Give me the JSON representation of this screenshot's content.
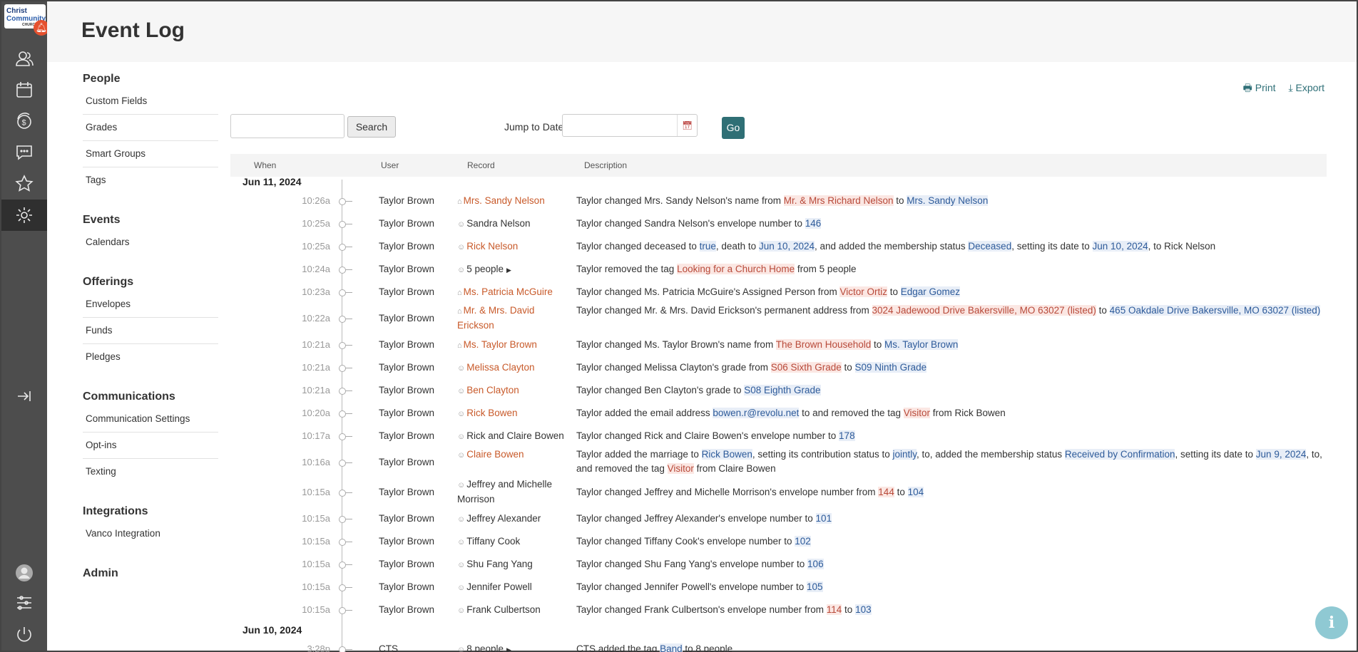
{
  "app": {
    "logo_line1": "Christ",
    "logo_line2": "Community",
    "logo_line3": "CHURCH",
    "notification_icon": "bell-icon",
    "rail_icons": [
      "people-icon",
      "calendar-icon",
      "offerings-icon",
      "messages-icon",
      "star-icon",
      "gear-icon",
      "collapse-icon",
      "avatar",
      "sliders-icon",
      "power-icon"
    ]
  },
  "header": {
    "title": "Event Log"
  },
  "subnav": {
    "sections": [
      {
        "title": "People",
        "items": [
          "Custom Fields",
          "Grades",
          "Smart Groups",
          "Tags"
        ]
      },
      {
        "title": "Events",
        "items": [
          "Calendars"
        ]
      },
      {
        "title": "Offerings",
        "items": [
          "Envelopes",
          "Funds",
          "Pledges"
        ]
      },
      {
        "title": "Communications",
        "items": [
          "Communication Settings",
          "Opt-ins",
          "Texting"
        ]
      },
      {
        "title": "Integrations",
        "items": [
          "Vanco Integration"
        ]
      },
      {
        "title": "Admin",
        "items": []
      }
    ]
  },
  "actions": {
    "print": "Print",
    "export": "Export"
  },
  "search": {
    "value": "",
    "button": "Search"
  },
  "jump": {
    "label": "Jump to Date",
    "value": "",
    "go": "Go"
  },
  "table": {
    "columns": {
      "when": "When",
      "user": "User",
      "record": "Record",
      "description": "Description"
    },
    "groups": [
      {
        "date": "Jun 11, 2024",
        "rows": [
          {
            "time": "10:26a",
            "user": "Taylor Brown",
            "record": "Mrs. Sandy Nelson",
            "record_type": "household",
            "link": true,
            "desc": [
              [
                "Taylor changed Mrs. Sandy Nelson's name from ",
                ""
              ],
              [
                "Mr. & Mrs Richard Nelson",
                "old"
              ],
              [
                " to ",
                ""
              ],
              [
                "Mrs. Sandy Nelson",
                "new"
              ]
            ]
          },
          {
            "time": "10:25a",
            "user": "Taylor Brown",
            "record": "Sandra Nelson",
            "record_type": "person",
            "link": false,
            "desc": [
              [
                "Taylor changed Sandra Nelson's envelope number to ",
                ""
              ],
              [
                "146",
                "new"
              ]
            ]
          },
          {
            "time": "10:25a",
            "user": "Taylor Brown",
            "record": "Rick Nelson",
            "record_type": "person",
            "link": true,
            "desc": [
              [
                "Taylor changed deceased to ",
                ""
              ],
              [
                "true",
                "new"
              ],
              [
                ", death to ",
                ""
              ],
              [
                "Jun 10, 2024",
                "new"
              ],
              [
                ", and added the membership status ",
                ""
              ],
              [
                "Deceased",
                "new"
              ],
              [
                ", setting its date to ",
                ""
              ],
              [
                "Jun 10, 2024",
                "new"
              ],
              [
                ", to Rick Nelson",
                ""
              ]
            ]
          },
          {
            "time": "10:24a",
            "user": "Taylor Brown",
            "record": "5 people",
            "record_type": "person",
            "link": false,
            "caret": true,
            "desc": [
              [
                "Taylor removed the tag ",
                ""
              ],
              [
                "Looking for a Church Home",
                "old"
              ],
              [
                " from 5 people",
                ""
              ]
            ]
          },
          {
            "time": "10:23a",
            "user": "Taylor Brown",
            "record": "Ms. Patricia McGuire",
            "record_type": "household",
            "link": true,
            "desc": [
              [
                "Taylor changed Ms. Patricia McGuire's Assigned Person from ",
                ""
              ],
              [
                "Victor Ortiz",
                "old"
              ],
              [
                " to ",
                ""
              ],
              [
                "Edgar Gomez",
                "new"
              ]
            ]
          },
          {
            "time": "10:22a",
            "user": "Taylor Brown",
            "record": "Mr. & Mrs. David Erickson",
            "record_type": "household",
            "link": true,
            "tall": true,
            "desc": [
              [
                "Taylor changed Mr. & Mrs. David Erickson's permanent address from ",
                ""
              ],
              [
                "3024 Jadewood Drive Bakersville, MO 63027 (listed)",
                "old"
              ],
              [
                " to ",
                ""
              ],
              [
                "465 Oakdale Drive Bakersville, MO 63027 (listed)",
                "new"
              ]
            ]
          },
          {
            "time": "10:21a",
            "user": "Taylor Brown",
            "record": "Ms. Taylor Brown",
            "record_type": "household",
            "link": true,
            "desc": [
              [
                "Taylor changed Ms. Taylor Brown's name from ",
                ""
              ],
              [
                "The Brown Household",
                "old"
              ],
              [
                " to ",
                ""
              ],
              [
                "Ms. Taylor Brown",
                "new"
              ]
            ]
          },
          {
            "time": "10:21a",
            "user": "Taylor Brown",
            "record": "Melissa Clayton",
            "record_type": "person",
            "link": true,
            "desc": [
              [
                "Taylor changed Melissa Clayton's grade from ",
                ""
              ],
              [
                "S06 Sixth Grade",
                "old"
              ],
              [
                " to ",
                ""
              ],
              [
                "S09 Ninth Grade",
                "new"
              ]
            ]
          },
          {
            "time": "10:21a",
            "user": "Taylor Brown",
            "record": "Ben Clayton",
            "record_type": "person",
            "link": true,
            "desc": [
              [
                "Taylor changed Ben Clayton's grade to ",
                ""
              ],
              [
                "S08 Eighth Grade",
                "new"
              ]
            ]
          },
          {
            "time": "10:20a",
            "user": "Taylor Brown",
            "record": "Rick Bowen",
            "record_type": "person",
            "link": true,
            "desc": [
              [
                "Taylor added the email address ",
                ""
              ],
              [
                "bowen.r@revolu.net",
                "new"
              ],
              [
                " to and removed the tag ",
                ""
              ],
              [
                "Visitor",
                "old"
              ],
              [
                " from Rick Bowen",
                ""
              ]
            ]
          },
          {
            "time": "10:17a",
            "user": "Taylor Brown",
            "record": "Rick and Claire Bowen",
            "record_type": "person",
            "link": false,
            "desc": [
              [
                "Taylor changed Rick and Claire Bowen's envelope number to ",
                ""
              ],
              [
                "178",
                "new"
              ]
            ]
          },
          {
            "time": "10:16a",
            "user": "Taylor Brown",
            "record": "Claire Bowen",
            "record_type": "person",
            "link": true,
            "tall": true,
            "desc": [
              [
                "Taylor added the marriage to ",
                ""
              ],
              [
                "Rick Bowen",
                "new"
              ],
              [
                ", setting its contribution status to ",
                ""
              ],
              [
                "jointly",
                "new"
              ],
              [
                ", to, added the membership status ",
                ""
              ],
              [
                "Received by Confirmation",
                "new"
              ],
              [
                ", setting its date to ",
                ""
              ],
              [
                "Jun 9, 2024",
                "new"
              ],
              [
                ", to, and removed the tag ",
                ""
              ],
              [
                "Visitor",
                "old"
              ],
              [
                " from Claire Bowen",
                ""
              ]
            ]
          },
          {
            "time": "10:15a",
            "user": "Taylor Brown",
            "record": "Jeffrey and Michelle Morrison",
            "record_type": "person",
            "link": false,
            "tall": true,
            "desc": [
              [
                "Taylor changed Jeffrey and Michelle Morrison's envelope number from ",
                ""
              ],
              [
                "144",
                "old"
              ],
              [
                " to ",
                ""
              ],
              [
                "104",
                "new"
              ]
            ]
          },
          {
            "time": "10:15a",
            "user": "Taylor Brown",
            "record": "Jeffrey Alexander",
            "record_type": "person",
            "link": false,
            "desc": [
              [
                "Taylor changed Jeffrey Alexander's envelope number to ",
                ""
              ],
              [
                "101",
                "new"
              ]
            ]
          },
          {
            "time": "10:15a",
            "user": "Taylor Brown",
            "record": "Tiffany Cook",
            "record_type": "person",
            "link": false,
            "desc": [
              [
                "Taylor changed Tiffany Cook's envelope number to ",
                ""
              ],
              [
                "102",
                "new"
              ]
            ]
          },
          {
            "time": "10:15a",
            "user": "Taylor Brown",
            "record": "Shu Fang Yang",
            "record_type": "person",
            "link": false,
            "desc": [
              [
                "Taylor changed Shu Fang Yang's envelope number to ",
                ""
              ],
              [
                "106",
                "new"
              ]
            ]
          },
          {
            "time": "10:15a",
            "user": "Taylor Brown",
            "record": "Jennifer Powell",
            "record_type": "person",
            "link": false,
            "desc": [
              [
                "Taylor changed Jennifer Powell's envelope number to ",
                ""
              ],
              [
                "105",
                "new"
              ]
            ]
          },
          {
            "time": "10:15a",
            "user": "Taylor Brown",
            "record": "Frank Culbertson",
            "record_type": "person",
            "link": false,
            "desc": [
              [
                "Taylor changed Frank Culbertson's envelope number from ",
                ""
              ],
              [
                "114",
                "old"
              ],
              [
                " to ",
                ""
              ],
              [
                "103",
                "new"
              ]
            ]
          }
        ]
      },
      {
        "date": "Jun 10, 2024",
        "rows": [
          {
            "time": "3:28p",
            "user": "CTS",
            "record": "8 people",
            "record_type": "person",
            "link": false,
            "caret": true,
            "desc": [
              [
                "CTS added the tag ",
                ""
              ],
              [
                "Band",
                "new"
              ],
              [
                " to 8 people",
                ""
              ]
            ]
          }
        ]
      }
    ]
  },
  "help": {
    "icon": "info-icon",
    "label": "i"
  },
  "colors": {
    "rail": "#4d4d4d",
    "accent": "#2f6f75",
    "link": "#c85a2a",
    "old_bg": "#fbe7e3",
    "new_bg": "#e8eef7"
  }
}
